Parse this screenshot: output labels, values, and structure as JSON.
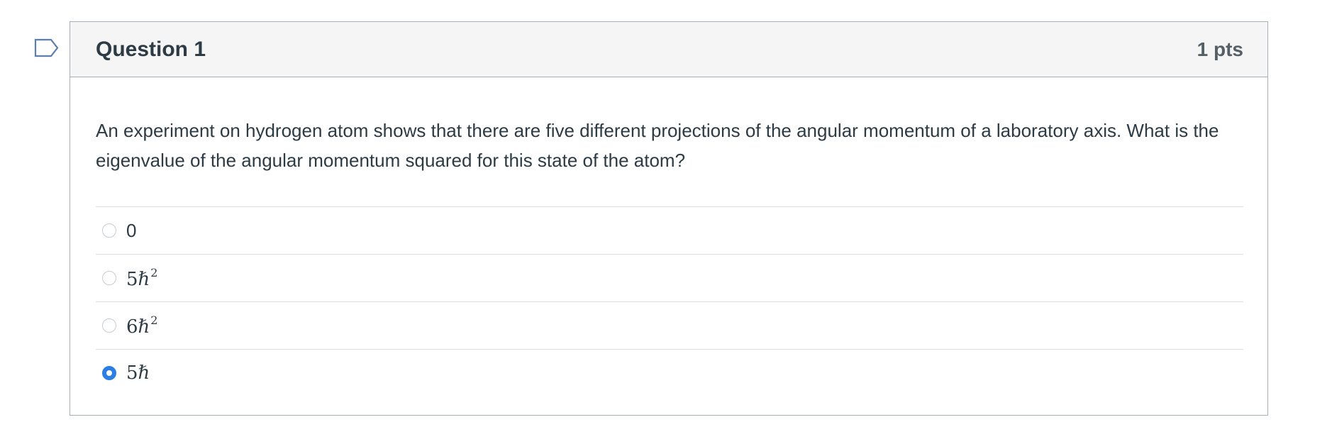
{
  "question": {
    "title": "Question 1",
    "points": "1 pts",
    "text": "An experiment on hydrogen atom shows that there are five different projections of the angular momentum of a laboratory axis. What is the eigenvalue of the angular momentum squared for this state of the atom?",
    "flag_icon": "flag-icon",
    "answers": [
      {
        "label": "0",
        "base": "0",
        "exponent": "",
        "selected": false
      },
      {
        "label": "5ℏ²",
        "base": "5ℏ",
        "exponent": "2",
        "selected": false
      },
      {
        "label": "6ℏ²",
        "base": "6ℏ",
        "exponent": "2",
        "selected": false
      },
      {
        "label": "5ℏ",
        "base": "5ℏ",
        "exponent": "",
        "selected": true
      }
    ]
  },
  "colors": {
    "accent": "#2b7ee4",
    "border": "#a5afb5",
    "header_bg": "#f5f5f5",
    "text": "#2d3b45"
  }
}
